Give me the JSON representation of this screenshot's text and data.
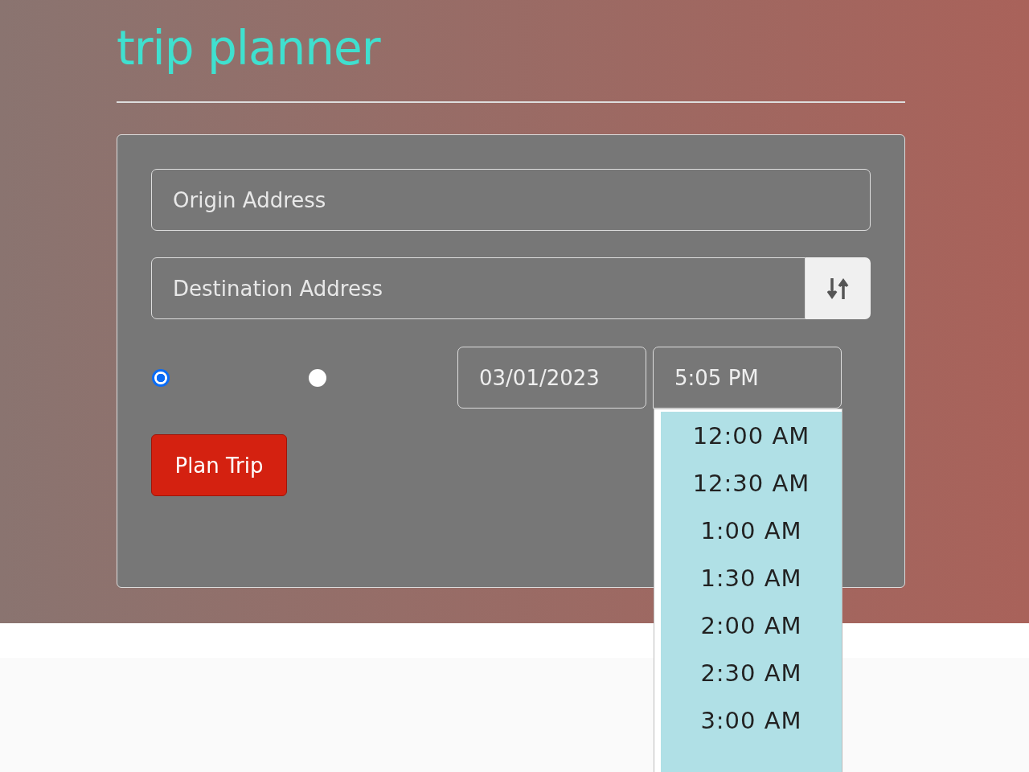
{
  "title": "trip planner",
  "origin": {
    "placeholder": "Origin Address"
  },
  "destination": {
    "placeholder": "Destination Address"
  },
  "radios": [
    {
      "selected": true
    },
    {
      "selected": false
    }
  ],
  "date": {
    "value": "03/01/2023"
  },
  "time": {
    "value": "5:05 PM",
    "expanded": true
  },
  "time_options": [
    {
      "label": "12:00 AM"
    },
    {
      "label": "12:30 AM"
    },
    {
      "label": "1:00 AM"
    },
    {
      "label": "1:30 AM"
    },
    {
      "label": "2:00 AM"
    },
    {
      "label": "2:30 AM"
    },
    {
      "label": "3:00 AM"
    }
  ],
  "plan_button": "Plan Trip"
}
